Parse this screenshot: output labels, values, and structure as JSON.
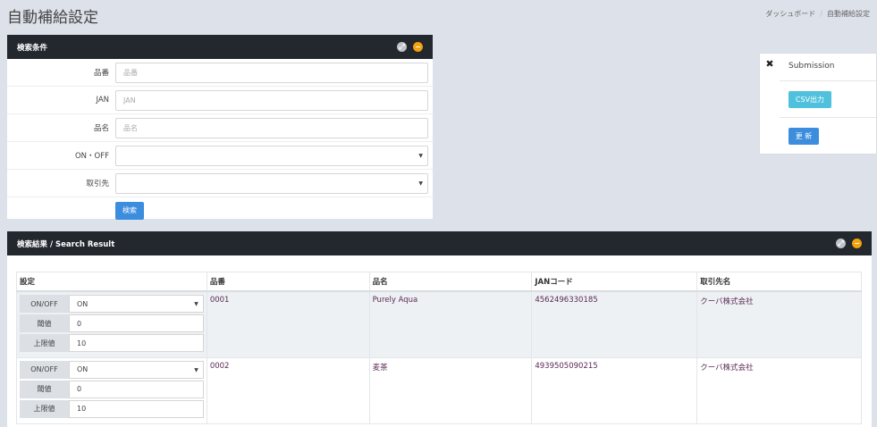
{
  "page": {
    "title": "自動補給設定",
    "breadcrumb": [
      "ダッシュボード",
      "自動補給設定"
    ]
  },
  "search_panel": {
    "title": "検索条件",
    "fields": {
      "hinban": {
        "label": "品番",
        "placeholder": "品番"
      },
      "jan": {
        "label": "JAN",
        "placeholder": "JAN"
      },
      "hinmei": {
        "label": "品名",
        "placeholder": "品名"
      },
      "onoff": {
        "label": "ON・OFF",
        "value": ""
      },
      "torihikisaki": {
        "label": "取引先",
        "value": ""
      }
    },
    "search_button": "検索"
  },
  "submission": {
    "title": "Submission",
    "csv_button": "CSV出力",
    "update_button": "更 新"
  },
  "results_panel": {
    "title": "検索結果 / Search Result",
    "columns": [
      "設定",
      "品番",
      "品名",
      "JANコード",
      "取引先名"
    ],
    "config_labels": {
      "onoff": "ON/OFF",
      "threshold": "閾値",
      "limit": "上限値"
    },
    "rows": [
      {
        "onoff": "ON",
        "threshold": "0",
        "limit": "10",
        "hinban": "0001",
        "hinmei": "Purely Aqua",
        "jan": "4562496330185",
        "torihikisaki": "クーバ株式会社"
      },
      {
        "onoff": "ON",
        "threshold": "0",
        "limit": "10",
        "hinban": "0002",
        "hinmei": "麦茶",
        "jan": "4939505090215",
        "torihikisaki": "クーバ株式会社"
      }
    ]
  },
  "icons": {
    "expand": "expand-icon",
    "collapse": "minus-circle-icon",
    "close": "close-x-icon",
    "caret": "caret-down-icon"
  },
  "colors": {
    "panel_header": "#23272e",
    "primary_button": "#3c8dde",
    "info_button": "#4fc1dc",
    "collapse_icon": "#f2a20f"
  }
}
